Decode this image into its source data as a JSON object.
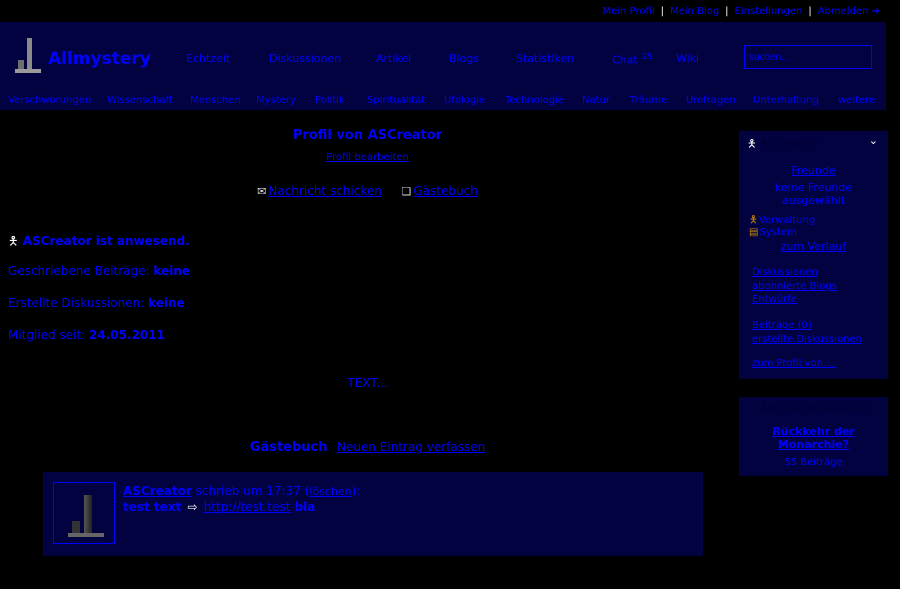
{
  "topbar": {
    "links": [
      "Mein Profil",
      "Mein Blog",
      "Einstellungen",
      "Abmelden"
    ],
    "logout_icon": "arrow-right-icon"
  },
  "header": {
    "brand": "Allmystery",
    "nav": [
      "Echtzeit",
      "Diskussionen",
      "Artikel",
      "Blogs",
      "Statistiken",
      "Chat",
      "Wiki"
    ],
    "chat_count": "28",
    "search_placeholder": "suchen...",
    "categories": [
      "Verschwörungen",
      "Wissenschaft",
      "Menschen",
      "Mystery",
      "Politik",
      "Spiritualität",
      "Ufologie",
      "Technologie",
      "Natur",
      "Träume",
      "Umfragen",
      "Unterhaltung",
      "weitere"
    ]
  },
  "profile": {
    "title": "Profil von ASCreator",
    "edit_link": "Profil bearbeiten",
    "message_link": "Nachricht schicken",
    "guestbook_link": "Gästebuch",
    "status_user": "ASCreator",
    "status_text": "ist anwesend.",
    "stats": [
      {
        "label": "Geschriebene Beiträge:",
        "value": "keine"
      },
      {
        "label": "Erstellte Diskussionen:",
        "value": "keine"
      },
      {
        "label": "Mitglied seit:",
        "value": "24.05.2011"
      }
    ],
    "text": "TEXT..."
  },
  "guestbook": {
    "title": "Gästebuch",
    "new_entry": "Neuen Eintrag verfassen",
    "entry": {
      "author": "ASCreator",
      "wrote": "schrieb um 17:37",
      "delete": "löschen",
      "text_before": "test text",
      "url": "http://test.test",
      "text_after": "bla"
    }
  },
  "sidebar": {
    "header": "ASCreator",
    "friends_label": "Freunde",
    "no_friends": "keine Freunde ausgewählt",
    "rows": [
      "Verwaltung",
      "System"
    ],
    "history_link": "zum Verlauf",
    "links_a": [
      "Diskussionen",
      "abonnierte Blogs",
      "Entwürfe"
    ],
    "links_b": [
      "Beiträge (0)",
      "erstellte Diskussionen"
    ],
    "profile_link": "zum Profil von ...",
    "box2_header": "Aktuelle Diskussion",
    "box2_title": "Rückkehr der Monarchie?",
    "box2_count": "55 Beiträge"
  },
  "colors": {
    "link": "#0000ff",
    "panel": "#020240",
    "background": "#000000"
  }
}
